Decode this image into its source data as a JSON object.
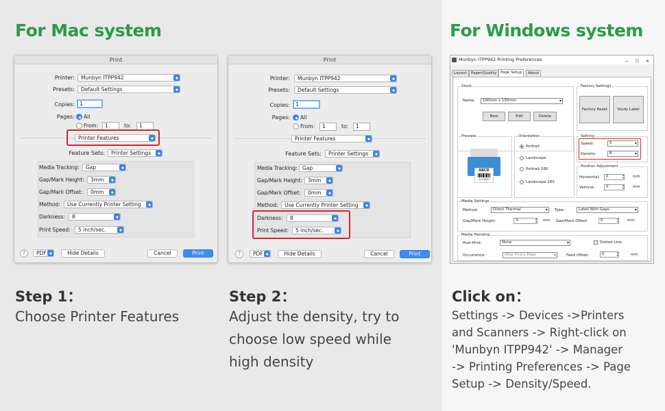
{
  "headings": {
    "mac": "For Mac system",
    "windows": "For Windows system"
  },
  "mac_dialog": {
    "title": "Print",
    "printer_label": "Printer:",
    "printer_value": "Munbyn ITPP942",
    "presets_label": "Presets:",
    "presets_value": "Default Settings",
    "copies_label": "Copies:",
    "copies_value": "1",
    "pages_label": "Pages:",
    "pages_all": "All",
    "pages_from": "From:",
    "from_value": "1",
    "to_label": "to:",
    "to_value": "1",
    "panel_select": "Printer Features",
    "feature_sets_label": "Feature Sets:",
    "feature_sets_value": "Printer Settings",
    "media_tracking_label": "Media Tracking:",
    "media_tracking_value": "Gap",
    "gap_height_label": "Gap/Mark Height:",
    "gap_height_value": "3mm",
    "gap_offset_label": "Gap/Mark Offset:",
    "gap_offset_value": "0mm",
    "method_label": "Method:",
    "method_value": "Use Currently Printer Setting",
    "darkness_label": "Darkness:",
    "darkness_value": "8",
    "speed_label": "Print Speed:",
    "speed_value": "5 inch/sec.",
    "help": "?",
    "pdf": "PDF",
    "hide_details": "Hide Details",
    "cancel": "Cancel",
    "print": "Print"
  },
  "win_dialog": {
    "title": "Munbyn ITPP942 Printing Preferences",
    "tabs": [
      "Layout",
      "Paper/Quality",
      "Page Setup",
      "About"
    ],
    "stock_group": "Stock",
    "name_label": "Name:",
    "name_value": "100mm x 150mm",
    "new_btn": "New",
    "edit_btn": "Edit",
    "delete_btn": "Delete",
    "factory_group": "Factory Settings",
    "factory_reset": "Factory Reset",
    "study_label": "Study Label",
    "preview_group": "Preview",
    "preview_text": "ABCD",
    "preview_num": "1234567",
    "orientation_group": "Orientation",
    "orient_portrait": "Portrait",
    "orient_landscape": "Landscape",
    "orient_portrait180": "Portrait 180",
    "orient_landscape180": "Landscape 180",
    "setting_group": "Setting",
    "speed_label": "Speed:",
    "speed_value": "5",
    "density_label": "Density:",
    "density_value": "8",
    "position_group": "Position Adjustment",
    "horizontal_label": "Horizontal:",
    "horizontal_value": "0",
    "vertical_label": "Vertical:",
    "vertical_value": "0",
    "unit_mm": "mm",
    "media_group": "Media Settings",
    "method_label": "Method:",
    "method_value": "Direct Thermal",
    "type_label": "Type:",
    "type_value": "Label With Gaps",
    "gap_height_label": "Gap/Mark Height:",
    "gap_height_value": "3",
    "gap_offset_label": "Gap/Mark Offset:",
    "gap_offset_value": "0",
    "handling_group": "Media Handing",
    "post_print_label": "Post-Print:",
    "post_print_value": "None",
    "dotted_line": "Dotted Line",
    "occurrence_label": "Occurrence:",
    "occurrence_value": "After Every Page",
    "feed_offset_label": "Feed Offset:",
    "feed_offset_value": "0"
  },
  "steps": {
    "step1_title": "Step 1：",
    "step1_text": "Choose Printer Features",
    "step2_title": "Step 2：",
    "step2_text_1": "Adjust the density, try to",
    "step2_text_2": "choose low speed while",
    "step2_text_3": "high density",
    "click_title": "Click on：",
    "click_text_1": "Settings -> Devices ->Printers",
    "click_text_2": "and Scanners -> Right-click on",
    "click_text_3": "'Munbyn ITPP942' -> Manager",
    "click_text_4": "-> Printing Preferences -> Page",
    "click_text_5": "Setup -> Density/Speed."
  },
  "colors": {
    "heading_green": "#2e9a4c",
    "highlight_red": "#d0262d",
    "mac_blue": "#3a86e8"
  }
}
